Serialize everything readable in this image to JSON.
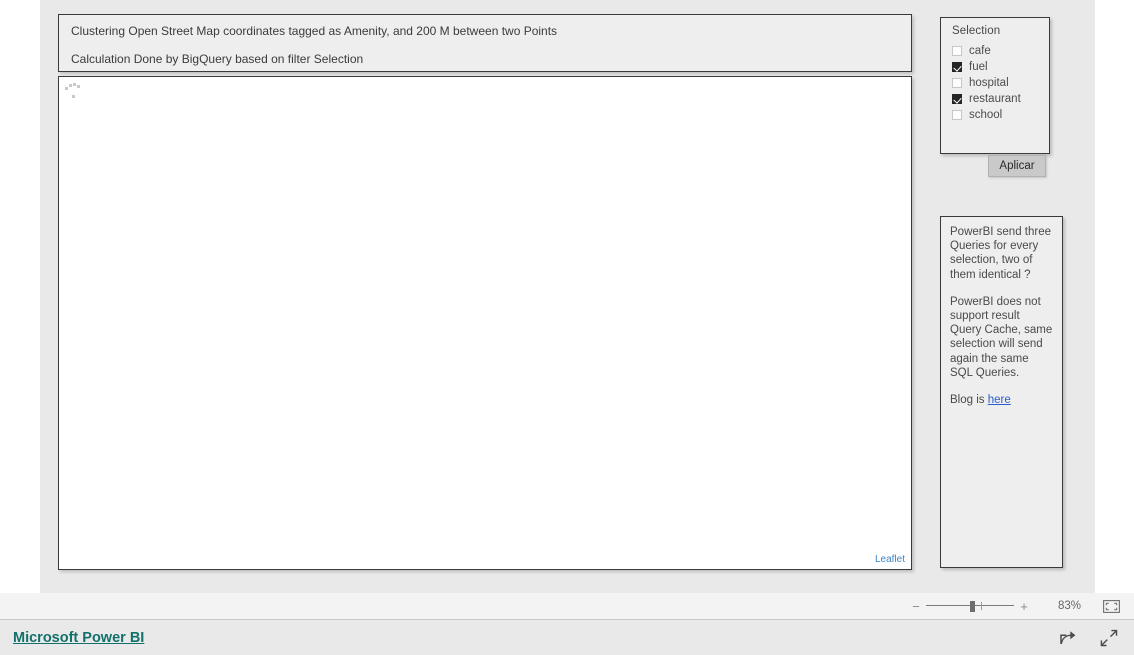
{
  "report": {
    "text_visual": {
      "lines": [
        "Clustering Open Street Map coordinates tagged as Amenity, and 200 M between two Points",
        "Calculation Done by BigQuery based on filter Selection"
      ]
    },
    "map_visual": {
      "attribution": "Leaflet"
    },
    "slicer": {
      "title": "Selection",
      "items": [
        {
          "label": "cafe",
          "checked": false
        },
        {
          "label": "fuel",
          "checked": true
        },
        {
          "label": "hospital",
          "checked": false
        },
        {
          "label": "restaurant",
          "checked": true
        },
        {
          "label": "school",
          "checked": false
        }
      ]
    },
    "apply_button": {
      "label": "Aplicar"
    },
    "notes_visual": {
      "paragraphs": [
        "PowerBI send three Queries for every selection, two of them identical ?",
        "PowerBI does not support result Query Cache, same selection will send again the same SQL Queries."
      ],
      "blog_prefix": "Blog is ",
      "blog_link_label": "here"
    }
  },
  "status_bar": {
    "zoom_out_label": "−",
    "zoom_in_label": "+",
    "zoom_percent": "83%",
    "fit_icon": "fit-to-page-icon"
  },
  "footer": {
    "brand": "Microsoft Power BI",
    "share_icon": "share-icon",
    "fullscreen_icon": "fullscreen-icon"
  },
  "colors": {
    "canvas_bg": "#e9e9e9",
    "visual_bg": "#eeeeee",
    "visual_border": "#3a3a3a",
    "brand_teal": "#12716b",
    "link_blue": "#2b5fcc",
    "leaflet_blue": "#3b86c6",
    "checkbox_checked": "#252525",
    "button_bg": "#c9c9c9"
  }
}
